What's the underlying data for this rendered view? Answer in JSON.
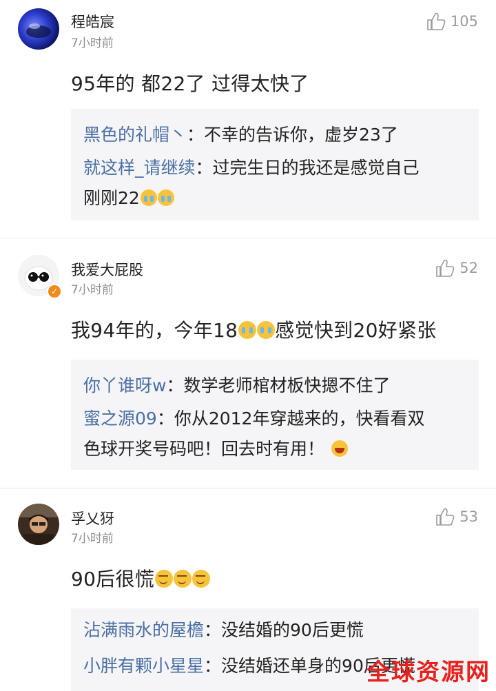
{
  "comments": [
    {
      "username": "程皓宸",
      "time": "7小时前",
      "likes": "105",
      "text": "95年的 都22了 过得太快了",
      "replies": [
        {
          "user": "黑色的礼帽丶",
          "sep": "：",
          "text": "不幸的告诉你，虚岁23了"
        },
        {
          "user": "就这样_请继续",
          "sep": "：",
          "text": "过完生日的我还是感觉自己",
          "text2": "刚刚22"
        }
      ]
    },
    {
      "username": "我爱大屁股",
      "time": "7小时前",
      "likes": "52",
      "text_a": "我94年的，今年18",
      "text_b": "感觉快到20好紧张",
      "replies": [
        {
          "user": "你丫谁呀w",
          "sep": "：",
          "text": "数学老师棺材板快摁不住了"
        },
        {
          "user": "蜜之源09",
          "sep": "：",
          "text": "你从2012年穿越来的，快看看双",
          "text2": "色球开奖号码吧！回去时有用！"
        }
      ]
    },
    {
      "username": "孚乂犽",
      "time": "7小时前",
      "likes": "53",
      "text": "90后很慌",
      "replies": [
        {
          "user": "沾满雨水的屋檐",
          "sep": "：",
          "text": "没结婚的90后更慌"
        },
        {
          "user": "小胖有颗小星星",
          "sep": "：",
          "text": "没结婚还单身的90后更慌"
        }
      ]
    }
  ],
  "watermark": "全球资源网",
  "colors": {
    "reply_user": "#4a6fa5",
    "reply_bg": "#f5f5f7",
    "meta": "#8e8e8e"
  }
}
